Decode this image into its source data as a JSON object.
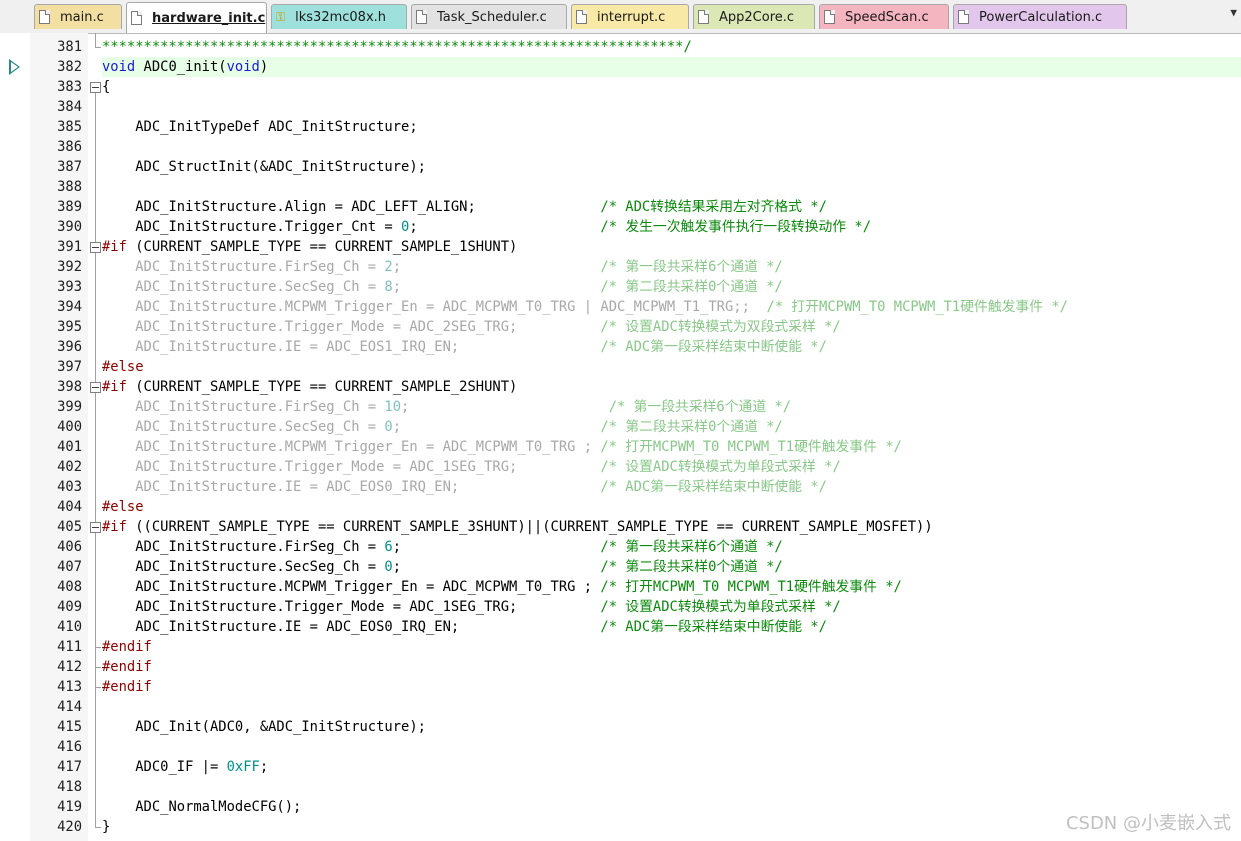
{
  "tabs": [
    {
      "label": "main.c",
      "icon": "file-icon",
      "color": "#f3dfa2",
      "active": false
    },
    {
      "label": "hardware_init.c",
      "icon": "file-icon",
      "color": "#ffffff",
      "active": true
    },
    {
      "label": "lks32mc08x.h",
      "icon": "key-icon",
      "color": "#9ee0dc",
      "active": false
    },
    {
      "label": "Task_Scheduler.c",
      "icon": "file-icon",
      "color": "#e2e2e2",
      "active": false
    },
    {
      "label": "interrupt.c",
      "icon": "file-icon",
      "color": "#f8eaa6",
      "active": false
    },
    {
      "label": "App2Core.c",
      "icon": "file-icon",
      "color": "#dbe8b6",
      "active": false
    },
    {
      "label": "SpeedScan.c",
      "icon": "file-icon",
      "color": "#f4b4c0",
      "active": false
    },
    {
      "label": "PowerCalculation.c",
      "icon": "file-icon",
      "color": "#e2c6ec",
      "active": false
    }
  ],
  "tab_overflow": "▼",
  "current_line": "382",
  "watermark": "CSDN @小麦嵌入式",
  "lines": [
    {
      "n": "381",
      "parts": [
        [
          "c",
          "**********************************************************************/"
        ]
      ]
    },
    {
      "n": "382",
      "parts": [
        [
          "k",
          "void"
        ],
        [
          "n",
          " ADC0_init("
        ],
        [
          "k",
          "void"
        ],
        [
          "n",
          ")"
        ]
      ]
    },
    {
      "n": "383",
      "parts": [
        [
          "n",
          "{"
        ]
      ]
    },
    {
      "n": "384",
      "parts": []
    },
    {
      "n": "385",
      "parts": [
        [
          "n",
          "    ADC_InitTypeDef ADC_InitStructure;"
        ]
      ]
    },
    {
      "n": "386",
      "parts": []
    },
    {
      "n": "387",
      "parts": [
        [
          "n",
          "    ADC_StructInit(&ADC_InitStructure);"
        ]
      ]
    },
    {
      "n": "388",
      "parts": []
    },
    {
      "n": "389",
      "parts": [
        [
          "n",
          "    ADC_InitStructure.Align = ADC_LEFT_ALIGN;               "
        ],
        [
          "c",
          "/* ADC转换结果采用左对齐格式 */"
        ]
      ]
    },
    {
      "n": "390",
      "parts": [
        [
          "n",
          "    ADC_InitStructure.Trigger_Cnt = "
        ],
        [
          "num-lit",
          "0"
        ],
        [
          "n",
          ";                      "
        ],
        [
          "c",
          "/* 发生一次触发事件执行一段转换动作 */"
        ]
      ]
    },
    {
      "n": "391",
      "parts": [
        [
          "p",
          "#if"
        ],
        [
          "n",
          " (CURRENT_SAMPLE_TYPE == CURRENT_SAMPLE_1SHUNT)"
        ]
      ]
    },
    {
      "n": "392",
      "parts": [
        [
          "g",
          "    ADC_InitStructure.FirSeg_Ch = "
        ],
        [
          "g-num",
          "2"
        ],
        [
          "g",
          ";                        "
        ],
        [
          "gc",
          "/* 第一段共采样6个通道 */"
        ]
      ]
    },
    {
      "n": "393",
      "parts": [
        [
          "g",
          "    ADC_InitStructure.SecSeg_Ch = "
        ],
        [
          "g-num",
          "8"
        ],
        [
          "g",
          ";                        "
        ],
        [
          "gc",
          "/* 第二段共采样0个通道 */"
        ]
      ]
    },
    {
      "n": "394",
      "parts": [
        [
          "g",
          "    ADC_InitStructure.MCPWM_Trigger_En = ADC_MCPWM_T0_TRG | ADC_MCPWM_T1_TRG;;  "
        ],
        [
          "gc",
          "/* 打开MCPWM_T0 MCPWM_T1硬件触发事件 */"
        ]
      ]
    },
    {
      "n": "395",
      "parts": [
        [
          "g",
          "    ADC_InitStructure.Trigger_Mode = ADC_2SEG_TRG;          "
        ],
        [
          "gc",
          "/* 设置ADC转换模式为双段式采样 */"
        ]
      ]
    },
    {
      "n": "396",
      "parts": [
        [
          "g",
          "    ADC_InitStructure.IE = ADC_EOS1_IRQ_EN;                 "
        ],
        [
          "gc",
          "/* ADC第一段采样结束中断使能 */"
        ]
      ]
    },
    {
      "n": "397",
      "parts": [
        [
          "p",
          "#else"
        ]
      ]
    },
    {
      "n": "398",
      "parts": [
        [
          "p",
          "#if"
        ],
        [
          "n",
          " (CURRENT_SAMPLE_TYPE == CURRENT_SAMPLE_2SHUNT)"
        ]
      ]
    },
    {
      "n": "399",
      "parts": [
        [
          "g",
          "    ADC_InitStructure.FirSeg_Ch = "
        ],
        [
          "g-num",
          "10"
        ],
        [
          "g",
          ";                        "
        ],
        [
          "gc",
          "/* 第一段共采样6个通道 */"
        ]
      ]
    },
    {
      "n": "400",
      "parts": [
        [
          "g",
          "    ADC_InitStructure.SecSeg_Ch = "
        ],
        [
          "g-num",
          "0"
        ],
        [
          "g",
          ";                        "
        ],
        [
          "gc",
          "/* 第二段共采样0个通道 */"
        ]
      ]
    },
    {
      "n": "401",
      "parts": [
        [
          "g",
          "    ADC_InitStructure.MCPWM_Trigger_En = ADC_MCPWM_T0_TRG ; "
        ],
        [
          "gc",
          "/* 打开MCPWM_T0 MCPWM_T1硬件触发事件 */"
        ]
      ]
    },
    {
      "n": "402",
      "parts": [
        [
          "g",
          "    ADC_InitStructure.Trigger_Mode = ADC_1SEG_TRG;          "
        ],
        [
          "gc",
          "/* 设置ADC转换模式为单段式采样 */"
        ]
      ]
    },
    {
      "n": "403",
      "parts": [
        [
          "g",
          "    ADC_InitStructure.IE = ADC_EOS0_IRQ_EN;                 "
        ],
        [
          "gc",
          "/* ADC第一段采样结束中断使能 */"
        ]
      ]
    },
    {
      "n": "404",
      "parts": [
        [
          "p",
          "#else"
        ]
      ]
    },
    {
      "n": "405",
      "parts": [
        [
          "p",
          "#if"
        ],
        [
          "n",
          " ((CURRENT_SAMPLE_TYPE == CURRENT_SAMPLE_3SHUNT)||(CURRENT_SAMPLE_TYPE == CURRENT_SAMPLE_MOSFET))"
        ]
      ]
    },
    {
      "n": "406",
      "parts": [
        [
          "n",
          "    ADC_InitStructure.FirSeg_Ch = "
        ],
        [
          "num-lit",
          "6"
        ],
        [
          "n",
          ";                        "
        ],
        [
          "c",
          "/* 第一段共采样6个通道 */"
        ]
      ]
    },
    {
      "n": "407",
      "parts": [
        [
          "n",
          "    ADC_InitStructure.SecSeg_Ch = "
        ],
        [
          "num-lit",
          "0"
        ],
        [
          "n",
          ";                        "
        ],
        [
          "c",
          "/* 第二段共采样0个通道 */"
        ]
      ]
    },
    {
      "n": "408",
      "parts": [
        [
          "n",
          "    ADC_InitStructure.MCPWM_Trigger_En = ADC_MCPWM_T0_TRG ; "
        ],
        [
          "c",
          "/* 打开MCPWM_T0 MCPWM_T1硬件触发事件 */"
        ]
      ]
    },
    {
      "n": "409",
      "parts": [
        [
          "n",
          "    ADC_InitStructure.Trigger_Mode = ADC_1SEG_TRG;          "
        ],
        [
          "c",
          "/* 设置ADC转换模式为单段式采样 */"
        ]
      ]
    },
    {
      "n": "410",
      "parts": [
        [
          "n",
          "    ADC_InitStructure.IE = ADC_EOS0_IRQ_EN;                 "
        ],
        [
          "c",
          "/* ADC第一段采样结束中断使能 */"
        ]
      ]
    },
    {
      "n": "411",
      "parts": [
        [
          "p",
          "#endif"
        ]
      ]
    },
    {
      "n": "412",
      "parts": [
        [
          "p",
          "#endif"
        ]
      ]
    },
    {
      "n": "413",
      "parts": [
        [
          "p",
          "#endif"
        ]
      ]
    },
    {
      "n": "414",
      "parts": []
    },
    {
      "n": "415",
      "parts": [
        [
          "n",
          "    ADC_Init(ADC0, &ADC_InitStructure);"
        ]
      ]
    },
    {
      "n": "416",
      "parts": []
    },
    {
      "n": "417",
      "parts": [
        [
          "n",
          "    ADC0_IF |= "
        ],
        [
          "num-lit",
          "0xFF"
        ],
        [
          "n",
          ";"
        ]
      ]
    },
    {
      "n": "418",
      "parts": []
    },
    {
      "n": "419",
      "parts": [
        [
          "n",
          "    ADC_NormalModeCFG();"
        ]
      ]
    },
    {
      "n": "420",
      "parts": [
        [
          "n",
          "}"
        ]
      ]
    }
  ]
}
